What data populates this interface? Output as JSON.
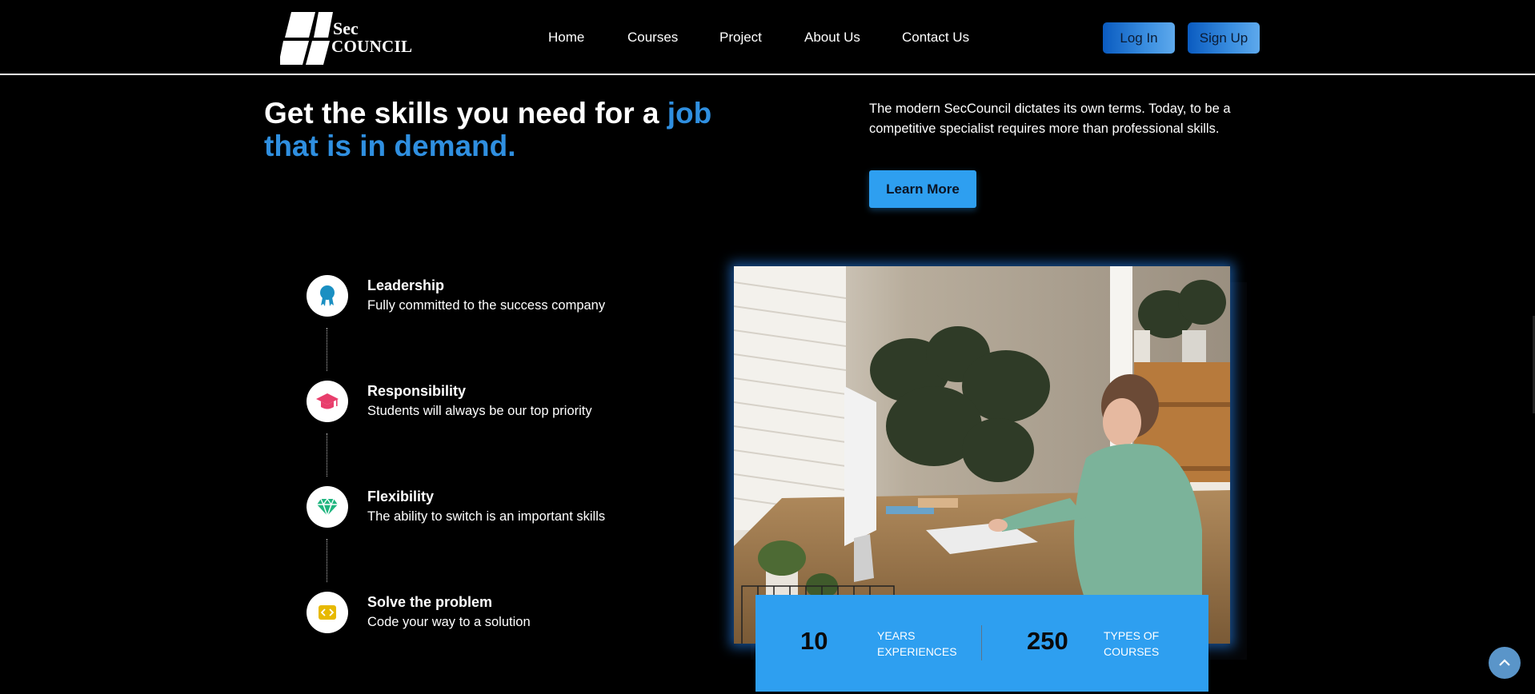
{
  "header": {
    "logo": {
      "line1": "Sec",
      "line2": "COUNCIL"
    },
    "nav": [
      {
        "label": "Home"
      },
      {
        "label": "Courses"
      },
      {
        "label": "Project"
      },
      {
        "label": "About Us"
      },
      {
        "label": "Contact Us"
      }
    ],
    "login_label": "Log In",
    "signup_label": "Sign Up"
  },
  "hero": {
    "title_plain": "Get the skills you need for a ",
    "title_accent": "job that is in demand.",
    "description": "The modern SecCouncil dictates its own terms. Today, to be a competitive specialist requires more than professional skills.",
    "cta_label": "Learn More"
  },
  "features": [
    {
      "title": "Leadership",
      "desc": "Fully committed to the success company",
      "icon": "award-icon",
      "color": "#1a8fc2"
    },
    {
      "title": "Responsibility",
      "desc": "Students will always be our top priority",
      "icon": "graduation-cap-icon",
      "color": "#e83e6c"
    },
    {
      "title": "Flexibility",
      "desc": "The ability to switch is an important skills",
      "icon": "diamond-icon",
      "color": "#1fb57f"
    },
    {
      "title": "Solve the problem",
      "desc": "Code your way to a solution",
      "icon": "code-icon",
      "color": "#e7b900"
    }
  ],
  "stats": [
    {
      "number": "10",
      "label": "YEARS EXPERIENCES"
    },
    {
      "number": "250",
      "label": "TYPES OF COURSES"
    }
  ],
  "colors": {
    "accent": "#2e9ff0",
    "background": "#000000"
  }
}
